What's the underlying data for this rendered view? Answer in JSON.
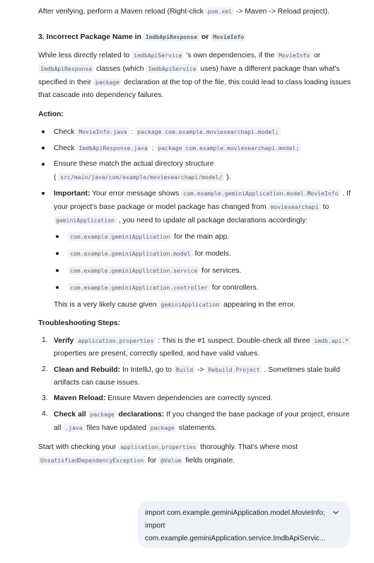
{
  "intro": {
    "t1": "After verifying, perform a Maven reload (Right-click ",
    "c1": "pom.xml",
    "t2": " -> Maven -> Reload project)."
  },
  "section3": {
    "h1": "3. Incorrect Package Name in ",
    "hc1": "ImdbApiResponse",
    "h2": " or ",
    "hc2": "MovieInfo",
    "p": {
      "t1": "While less directly related to ",
      "c1": "imdbApiService",
      "t2": " 's own dependencies, if the ",
      "c2": "MovieInfo",
      "t3": " or ",
      "c3": "ImdbApiResponse",
      "t4": " classes (which ",
      "c4": "ImdbApiService",
      "t5": " uses) have a different package than what's specified in their ",
      "c5": "package",
      "t6": " declaration at the top of the file, this could lead to class loading issues that cascade into dependency failures."
    },
    "action_label": "Action:",
    "b1": {
      "t1": "Check ",
      "c1": "MovieInfo.java",
      "t2": " : ",
      "c2": "package com.example.moviesearchapi.model;"
    },
    "b2": {
      "t1": "Check ",
      "c1": "ImdbApiResponse.java",
      "t2": " : ",
      "c2": "package com.example.moviesearchapi.model;"
    },
    "b3": {
      "t1": "Ensure these match the actual directory structure",
      "t2": "( ",
      "c1": "src/main/java/com/example/moviesearchapi/model/",
      "t3": " )."
    },
    "b4": {
      "bold": "Important:",
      "t1": " Your error message shows ",
      "c1": "com.example.geminiApplication.model.MovieInfo",
      "t2": " . If your project's base package or model package has changed from ",
      "c2": "moviesearchapi",
      "t3": " to ",
      "c3": "geminiApplication",
      "t4": " , you need to update all package declarations accordingly:",
      "sub": [
        {
          "code": "com.example.geminiApplication",
          "text": " for the main app."
        },
        {
          "code": "com.example.geminiApplication.model",
          "text": " for models."
        },
        {
          "code": "com.example.geminiApplication.service",
          "text": " for services."
        },
        {
          "code": "com.example.geminiApplication.controller",
          "text": " for controllers."
        }
      ],
      "after_t1": "This is a very likely cause given ",
      "after_c1": "geminiApplication",
      "after_t2": " appearing in the error."
    }
  },
  "troubleshooting": {
    "label": "Troubleshooting Steps:",
    "s1": {
      "num": "1.",
      "bold": "Verify ",
      "c1": "application.properties",
      "t1": " : This is the #1 suspect. Double-check all three ",
      "c2": "imdb.api.*",
      "t2": " properties are present, correctly spelled, and have valid values."
    },
    "s2": {
      "num": "2.",
      "bold": "Clean and Rebuild:",
      "t1": " In IntelliJ, go to ",
      "c1": "Build",
      "t2": " -> ",
      "c2": "Rebuild Project",
      "t3": " . Sometimes stale build artifacts can cause issues."
    },
    "s3": {
      "num": "3.",
      "bold": "Maven Reload:",
      "t1": " Ensure Maven dependencies are correctly synced."
    },
    "s4": {
      "num": "4.",
      "bold1": "Check all ",
      "c1": "package",
      "bold2": " declarations:",
      "t1": " If you changed the base package of your project, ensure all ",
      "c2": ".java",
      "t2": " files have updated ",
      "c3": "package",
      "t3": " statements."
    }
  },
  "closing": {
    "t1": "Start with checking your ",
    "c1": "application.properties",
    "t2": " thoroughly. That's where most ",
    "c2": "UnsatisfiedDependencyException",
    "t3": " for ",
    "c3": "@Value",
    "t4": " fields originate."
  },
  "user_message": {
    "line1": "import com.example.geminiApplication.model.MovieInfo;",
    "line2": "import",
    "line3": "com.example.geminiApplication.service.ImdbApiServic...",
    "expand_icon": "chevron-down-icon"
  }
}
